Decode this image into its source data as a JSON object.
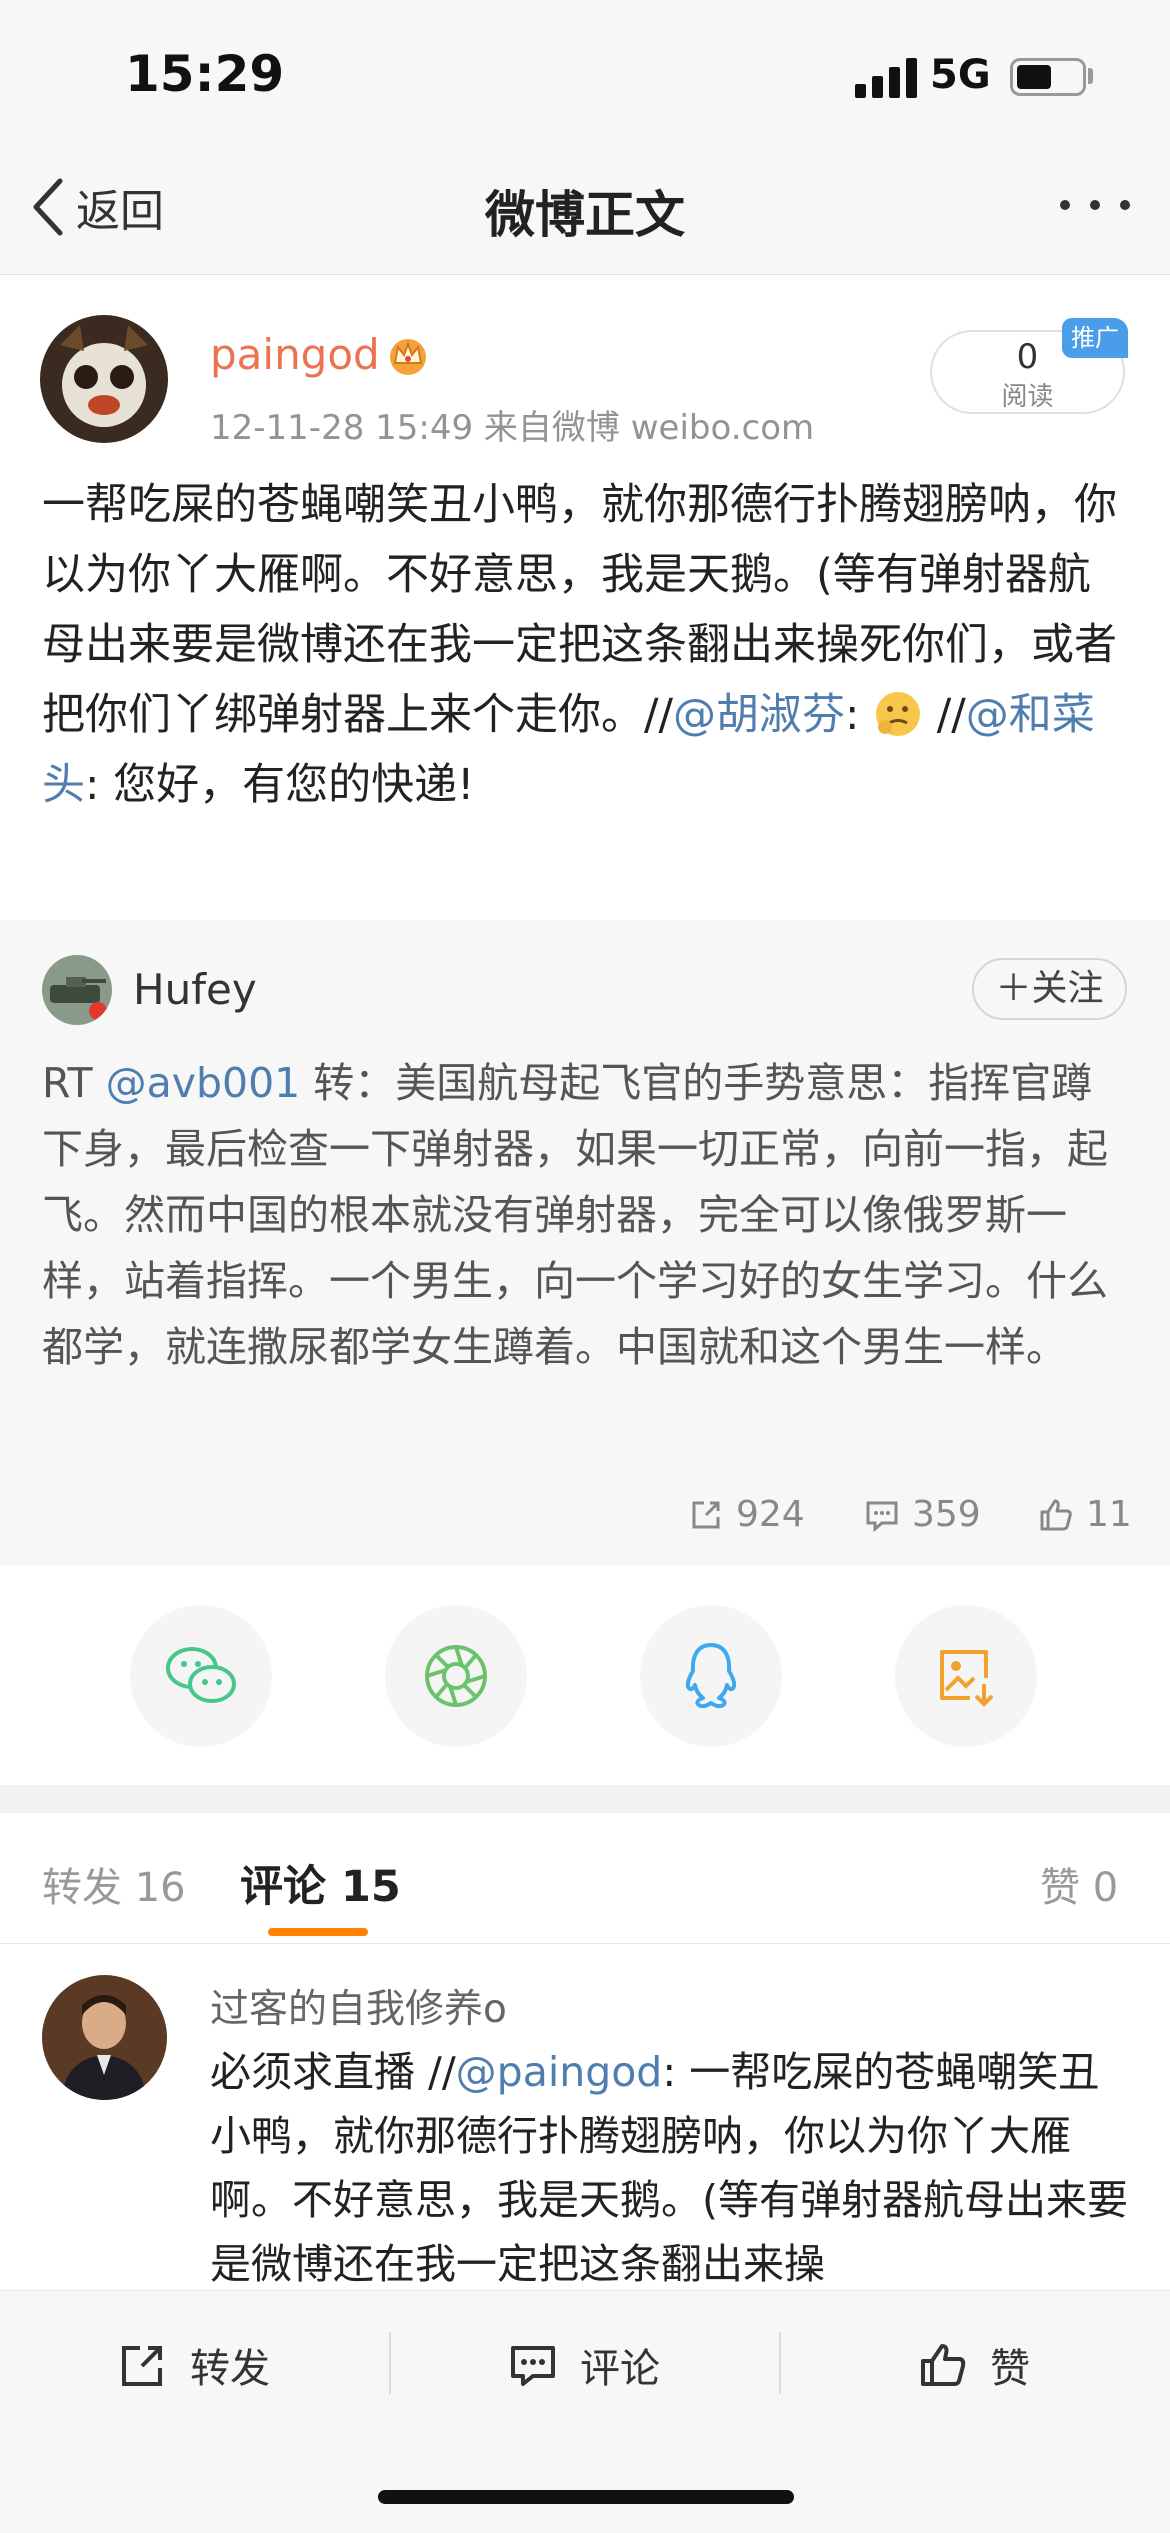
{
  "status_bar": {
    "time": "15:29",
    "network": "5G"
  },
  "nav": {
    "back_label": "返回",
    "title": "微博正文"
  },
  "post": {
    "username": "paingod",
    "meta": "12-11-28 15:49  来自微博 weibo.com",
    "read_count": "0",
    "read_label": "阅读",
    "promo_badge": "推广",
    "body_1": "一帮吃屎的苍蝇嘲笑丑小鸭，就你那德行扑腾翅膀呐，你以为你丫大雁啊。不好意思，我是天鹅。(等有弹射器航母出来要是微博还在我一定把这条翻出来操死你们，或者把你们丫绑弹射器上来个走你。//",
    "mention_1": "@胡淑芬",
    "colon_1": ": ",
    "sep": " //",
    "mention_2": "@和菜头",
    "body_2": ": 您好，有您的快递!"
  },
  "retweet": {
    "username": "Hufey",
    "follow_label": "＋关注",
    "body_prefix": "RT ",
    "mention": "@avb001",
    "body": " 转：美国航母起飞官的手势意思：指挥官蹲下身，最后检查一下弹射器，如果一切正常，向前一指，起飞。然而中国的根本就没有弹射器，完全可以像俄罗斯一样，站着指挥。一个男生，向一个学习好的女生学习。什么都学，就连撒尿都学女生蹲着。中国就和这个男生一样。",
    "reposts": "924",
    "comments": "359",
    "likes": "11"
  },
  "tabs": {
    "repost": "转发 16",
    "comment": "评论 15",
    "likes": "赞 0"
  },
  "comment": {
    "username": "过客的自我修养o",
    "prefix": "必须求直播 //",
    "mention": "@paingod",
    "body": ": 一帮吃屎的苍蝇嘲笑丑小鸭，就你那德行扑腾翅膀呐，你以为你丫大雁啊。不好意思，我是天鹅。(等有弹射器航母出来要是微博还在我一定把这条翻出来操"
  },
  "toolbar": {
    "repost": "转发",
    "comment": "评论",
    "like": "赞"
  },
  "colors": {
    "accent": "#ff8200",
    "link": "#507daf",
    "username": "#eb7350",
    "badge": "#4a9de8"
  }
}
